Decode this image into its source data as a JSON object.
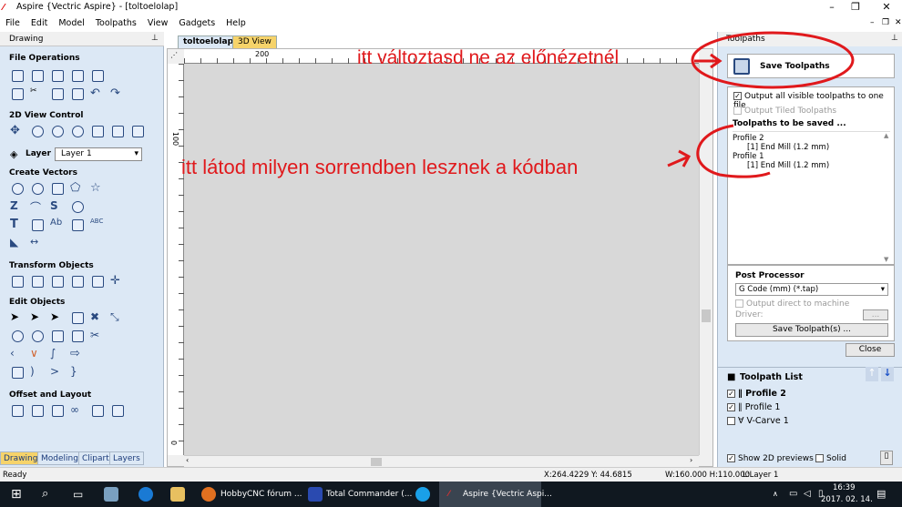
{
  "title": "Aspire {Vectric Aspire} - [toltoelolap]",
  "menu": [
    "File",
    "Edit",
    "Model",
    "Toolpaths",
    "View",
    "Gadgets",
    "Help"
  ],
  "left_panel": {
    "title": "Drawing",
    "sections": [
      "File Operations",
      "2D View Control",
      "Create Vectors",
      "Transform Objects",
      "Edit Objects",
      "Offset and Layout"
    ],
    "layer_label": "Layer",
    "layer_value": "Layer 1",
    "tabs": [
      "Drawing",
      "Modeling",
      "Clipart",
      "Layers"
    ]
  },
  "doc_tabs": [
    "toltoelolap",
    "3D View"
  ],
  "ruler": {
    "top_label": "200",
    "left_label": "100",
    "left_zero": "0"
  },
  "right_panel": {
    "title": "Toolpaths",
    "save_title": "Save Toolpaths",
    "opt_all": "Output all visible toolpaths to one file",
    "opt_tiled": "Output Tiled Toolpaths",
    "to_save_title": "Toolpaths to be saved ...",
    "to_save": [
      "Profile 2",
      "[1] End Mill (1.2 mm)",
      "Profile 1",
      "[1] End Mill (1.2 mm)"
    ],
    "pp_title": "Post Processor",
    "pp_value": "G Code (mm) (*.tap)",
    "pp_direct": "Output direct to machine",
    "driver_label": "Driver:",
    "driver_btn": "...",
    "save_btn": "Save Toolpath(s) ...",
    "close_btn": "Close",
    "list_title": "Toolpath List",
    "list_items": [
      {
        "name": "Profile 2",
        "checked": true
      },
      {
        "name": "Profile 1",
        "checked": true
      },
      {
        "name": "V-Carve 1",
        "checked": false
      }
    ],
    "show_2d": "Show 2D previews",
    "solid": "Solid"
  },
  "status": {
    "left": "Ready",
    "coords": "X:264.4229 Y: 44.6815",
    "dims": "W:160.000  H:110.000",
    "layer": "L:Layer 1"
  },
  "taskbar": {
    "items": [
      "HobbyCNC fórum ...",
      "Total Commander (...",
      "Aspire {Vectric Aspi..."
    ],
    "time": "16:39",
    "date": "2017. 02. 14."
  },
  "annotations": {
    "top": "itt változtasd ne az előnézetnél",
    "middle": "itt látod milyen sorrendben lesznek a kódban"
  },
  "colors": {
    "panel": "#dce8f5",
    "canvas": "#d8d8d8",
    "annotation": "#e0191c",
    "taskbar": "#101820"
  }
}
